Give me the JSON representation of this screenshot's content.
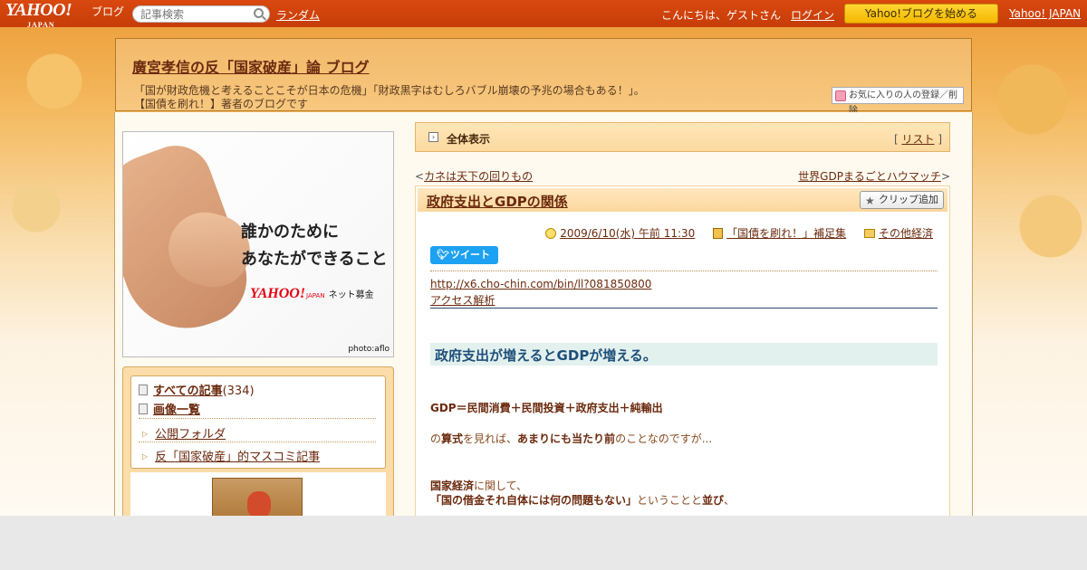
{
  "topbar": {
    "logo_text": "YAHOO!",
    "logo_sub": "JAPAN",
    "logo_blog": "ブログ",
    "search_placeholder": "記事検索",
    "random_label": "ランダム",
    "greeting": "こんにちは、ゲストさん",
    "login_label": "ログイン",
    "start_button": "Yahoo!ブログを始める",
    "yahoo_japan_link": "Yahoo! JAPAN"
  },
  "header": {
    "blog_title": "廣宮孝信の反「国家破産」論 ブログ",
    "description_line1": "「国が財政危機と考えることこそが日本の危機」「財政黒字はむしろバブル崩壊の予兆の場合もある！」。",
    "description_line2": "【国債を刷れ！】著者のブログです",
    "favorite_button": "お気に入りの人の登録／削除"
  },
  "ad": {
    "line1": "誰かのために",
    "line2": "あなたができること",
    "logo": "YAHOO!",
    "logo_sub": "JAPAN",
    "logo_tail": "ネット募金",
    "credit": "photo:aflo"
  },
  "sidebar": {
    "all_articles_label": "すべての記事",
    "all_articles_count": "(334)",
    "images_label": "画像一覧",
    "folders": [
      "公開フォルダ",
      "反「国家破産」的マスコミ記事"
    ]
  },
  "main": {
    "all_view_label": "全体表示",
    "list_bracket_open": "[",
    "list_label": "リスト",
    "list_bracket_close": "]",
    "prev_marker": "<",
    "prev_link": "カネは天下の回りもの",
    "next_link": "世界GDPまるごとハウマッチ",
    "next_marker": ">"
  },
  "article": {
    "title": "政府支出とGDPの関係",
    "clip_button": "クリップ追加",
    "date": "2009/6/10(水) 午前 11:30",
    "category": "「国債を刷れ！」補足集",
    "folder": "その他経済",
    "tweet_button": "ツイート",
    "url_link": "http://x6.cho-chin.com/bin/ll?081850800",
    "access_link": "アクセス解析",
    "heading": "政府支出が増えるとGDPが増える。",
    "formula": "GDP＝民間消費＋民間投資＋政府支出＋純輸出",
    "line_a_pre": "の",
    "line_a_b1": "算式",
    "line_a_mid": "を見れば、",
    "line_a_b2": "あまりにも当たり前",
    "line_a_post": "のことなのですが...",
    "line_b_b": "国家経済",
    "line_b_post": "に関して、",
    "line_c_b1": "「国の借金それ自体には何の問題もない」",
    "line_c_mid": "ということと",
    "line_c_b2": "並び",
    "line_c_post": "、"
  }
}
